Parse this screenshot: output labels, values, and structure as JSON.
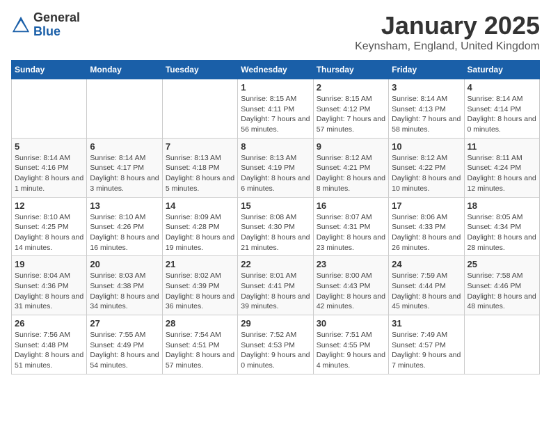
{
  "header": {
    "logo_general": "General",
    "logo_blue": "Blue",
    "month_title": "January 2025",
    "location": "Keynsham, England, United Kingdom"
  },
  "weekdays": [
    "Sunday",
    "Monday",
    "Tuesday",
    "Wednesday",
    "Thursday",
    "Friday",
    "Saturday"
  ],
  "weeks": [
    [
      {
        "day": "",
        "sunrise": "",
        "sunset": "",
        "daylight": ""
      },
      {
        "day": "",
        "sunrise": "",
        "sunset": "",
        "daylight": ""
      },
      {
        "day": "",
        "sunrise": "",
        "sunset": "",
        "daylight": ""
      },
      {
        "day": "1",
        "sunrise": "Sunrise: 8:15 AM",
        "sunset": "Sunset: 4:11 PM",
        "daylight": "Daylight: 7 hours and 56 minutes."
      },
      {
        "day": "2",
        "sunrise": "Sunrise: 8:15 AM",
        "sunset": "Sunset: 4:12 PM",
        "daylight": "Daylight: 7 hours and 57 minutes."
      },
      {
        "day": "3",
        "sunrise": "Sunrise: 8:14 AM",
        "sunset": "Sunset: 4:13 PM",
        "daylight": "Daylight: 7 hours and 58 minutes."
      },
      {
        "day": "4",
        "sunrise": "Sunrise: 8:14 AM",
        "sunset": "Sunset: 4:14 PM",
        "daylight": "Daylight: 8 hours and 0 minutes."
      }
    ],
    [
      {
        "day": "5",
        "sunrise": "Sunrise: 8:14 AM",
        "sunset": "Sunset: 4:16 PM",
        "daylight": "Daylight: 8 hours and 1 minute."
      },
      {
        "day": "6",
        "sunrise": "Sunrise: 8:14 AM",
        "sunset": "Sunset: 4:17 PM",
        "daylight": "Daylight: 8 hours and 3 minutes."
      },
      {
        "day": "7",
        "sunrise": "Sunrise: 8:13 AM",
        "sunset": "Sunset: 4:18 PM",
        "daylight": "Daylight: 8 hours and 5 minutes."
      },
      {
        "day": "8",
        "sunrise": "Sunrise: 8:13 AM",
        "sunset": "Sunset: 4:19 PM",
        "daylight": "Daylight: 8 hours and 6 minutes."
      },
      {
        "day": "9",
        "sunrise": "Sunrise: 8:12 AM",
        "sunset": "Sunset: 4:21 PM",
        "daylight": "Daylight: 8 hours and 8 minutes."
      },
      {
        "day": "10",
        "sunrise": "Sunrise: 8:12 AM",
        "sunset": "Sunset: 4:22 PM",
        "daylight": "Daylight: 8 hours and 10 minutes."
      },
      {
        "day": "11",
        "sunrise": "Sunrise: 8:11 AM",
        "sunset": "Sunset: 4:24 PM",
        "daylight": "Daylight: 8 hours and 12 minutes."
      }
    ],
    [
      {
        "day": "12",
        "sunrise": "Sunrise: 8:10 AM",
        "sunset": "Sunset: 4:25 PM",
        "daylight": "Daylight: 8 hours and 14 minutes."
      },
      {
        "day": "13",
        "sunrise": "Sunrise: 8:10 AM",
        "sunset": "Sunset: 4:26 PM",
        "daylight": "Daylight: 8 hours and 16 minutes."
      },
      {
        "day": "14",
        "sunrise": "Sunrise: 8:09 AM",
        "sunset": "Sunset: 4:28 PM",
        "daylight": "Daylight: 8 hours and 19 minutes."
      },
      {
        "day": "15",
        "sunrise": "Sunrise: 8:08 AM",
        "sunset": "Sunset: 4:30 PM",
        "daylight": "Daylight: 8 hours and 21 minutes."
      },
      {
        "day": "16",
        "sunrise": "Sunrise: 8:07 AM",
        "sunset": "Sunset: 4:31 PM",
        "daylight": "Daylight: 8 hours and 23 minutes."
      },
      {
        "day": "17",
        "sunrise": "Sunrise: 8:06 AM",
        "sunset": "Sunset: 4:33 PM",
        "daylight": "Daylight: 8 hours and 26 minutes."
      },
      {
        "day": "18",
        "sunrise": "Sunrise: 8:05 AM",
        "sunset": "Sunset: 4:34 PM",
        "daylight": "Daylight: 8 hours and 28 minutes."
      }
    ],
    [
      {
        "day": "19",
        "sunrise": "Sunrise: 8:04 AM",
        "sunset": "Sunset: 4:36 PM",
        "daylight": "Daylight: 8 hours and 31 minutes."
      },
      {
        "day": "20",
        "sunrise": "Sunrise: 8:03 AM",
        "sunset": "Sunset: 4:38 PM",
        "daylight": "Daylight: 8 hours and 34 minutes."
      },
      {
        "day": "21",
        "sunrise": "Sunrise: 8:02 AM",
        "sunset": "Sunset: 4:39 PM",
        "daylight": "Daylight: 8 hours and 36 minutes."
      },
      {
        "day": "22",
        "sunrise": "Sunrise: 8:01 AM",
        "sunset": "Sunset: 4:41 PM",
        "daylight": "Daylight: 8 hours and 39 minutes."
      },
      {
        "day": "23",
        "sunrise": "Sunrise: 8:00 AM",
        "sunset": "Sunset: 4:43 PM",
        "daylight": "Daylight: 8 hours and 42 minutes."
      },
      {
        "day": "24",
        "sunrise": "Sunrise: 7:59 AM",
        "sunset": "Sunset: 4:44 PM",
        "daylight": "Daylight: 8 hours and 45 minutes."
      },
      {
        "day": "25",
        "sunrise": "Sunrise: 7:58 AM",
        "sunset": "Sunset: 4:46 PM",
        "daylight": "Daylight: 8 hours and 48 minutes."
      }
    ],
    [
      {
        "day": "26",
        "sunrise": "Sunrise: 7:56 AM",
        "sunset": "Sunset: 4:48 PM",
        "daylight": "Daylight: 8 hours and 51 minutes."
      },
      {
        "day": "27",
        "sunrise": "Sunrise: 7:55 AM",
        "sunset": "Sunset: 4:49 PM",
        "daylight": "Daylight: 8 hours and 54 minutes."
      },
      {
        "day": "28",
        "sunrise": "Sunrise: 7:54 AM",
        "sunset": "Sunset: 4:51 PM",
        "daylight": "Daylight: 8 hours and 57 minutes."
      },
      {
        "day": "29",
        "sunrise": "Sunrise: 7:52 AM",
        "sunset": "Sunset: 4:53 PM",
        "daylight": "Daylight: 9 hours and 0 minutes."
      },
      {
        "day": "30",
        "sunrise": "Sunrise: 7:51 AM",
        "sunset": "Sunset: 4:55 PM",
        "daylight": "Daylight: 9 hours and 4 minutes."
      },
      {
        "day": "31",
        "sunrise": "Sunrise: 7:49 AM",
        "sunset": "Sunset: 4:57 PM",
        "daylight": "Daylight: 9 hours and 7 minutes."
      },
      {
        "day": "",
        "sunrise": "",
        "sunset": "",
        "daylight": ""
      }
    ]
  ]
}
